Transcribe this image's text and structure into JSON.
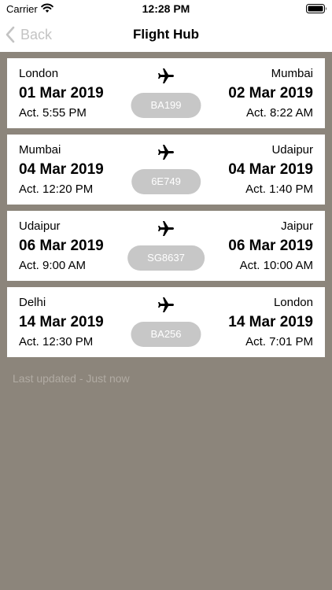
{
  "status_bar": {
    "carrier": "Carrier",
    "time": "12:28 PM"
  },
  "nav": {
    "back_label": "Back",
    "title": "Flight Hub"
  },
  "flights": [
    {
      "origin_city": "London",
      "origin_date": "01 Mar 2019",
      "origin_time": "Act. 5:55 PM",
      "flight_number": "BA199",
      "dest_city": "Mumbai",
      "dest_date": "02 Mar 2019",
      "dest_time": "Act. 8:22 AM"
    },
    {
      "origin_city": "Mumbai",
      "origin_date": "04 Mar 2019",
      "origin_time": "Act. 12:20 PM",
      "flight_number": "6E749",
      "dest_city": "Udaipur",
      "dest_date": "04 Mar 2019",
      "dest_time": "Act. 1:40 PM"
    },
    {
      "origin_city": "Udaipur",
      "origin_date": "06 Mar 2019",
      "origin_time": "Act. 9:00 AM",
      "flight_number": "SG8637",
      "dest_city": "Jaipur",
      "dest_date": "06 Mar 2019",
      "dest_time": "Act. 10:00 AM"
    },
    {
      "origin_city": "Delhi",
      "origin_date": "14 Mar 2019",
      "origin_time": "Act. 12:30 PM",
      "flight_number": "BA256",
      "dest_city": "London",
      "dest_date": "14 Mar 2019",
      "dest_time": "Act. 7:01 PM"
    }
  ],
  "footer": {
    "last_updated": "Last updated - Just now"
  },
  "icons": {
    "status": [
      "wifi-icon",
      "battery-icon"
    ],
    "nav": "chevron-left-icon",
    "flight": "plane-icon"
  },
  "colors": {
    "background": "#8c857b",
    "card": "#ffffff",
    "badge": "#c7c7c7",
    "back_tint": "#c3c3c3",
    "muted_text": "#b1aba3"
  }
}
